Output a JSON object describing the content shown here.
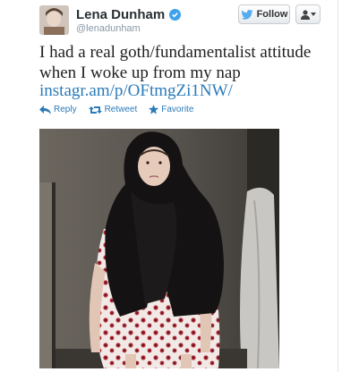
{
  "user": {
    "name": "Lena Dunham",
    "handle": "@lenadunham",
    "verified": true
  },
  "buttons": {
    "follow_label": "Follow"
  },
  "tweet": {
    "text": "I had a real goth/fundamentalist attitude when I woke up from my nap",
    "link": "instagr.am/p/OFtmgZi1NW/"
  },
  "actions": {
    "reply": "Reply",
    "retweet": "Retweet",
    "favorite": "Favorite"
  },
  "colors": {
    "link": "#2b7bb9",
    "verified": "#3ea1ec",
    "twitter_bird": "#55acee"
  }
}
